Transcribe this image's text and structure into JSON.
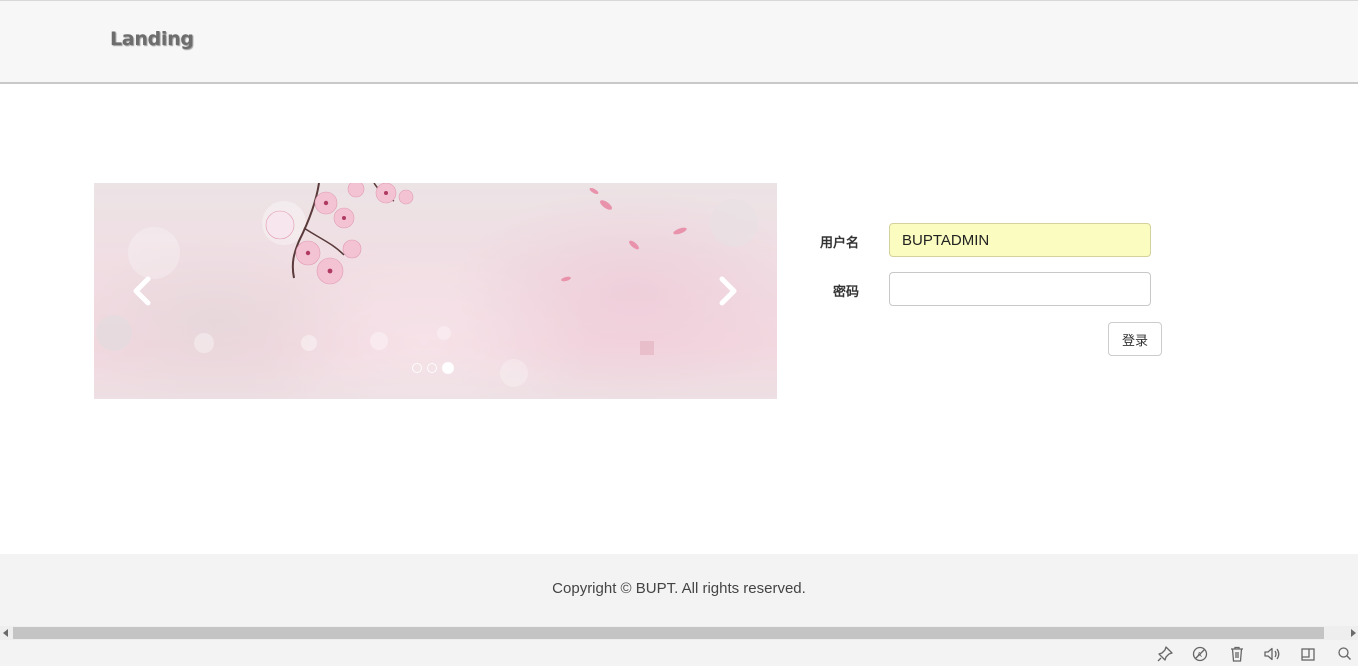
{
  "header": {
    "brand": "Landing"
  },
  "carousel": {
    "indicator_count": 3,
    "active_index": 2
  },
  "login_form": {
    "username_label": "用户名",
    "username_value": "BUPTADMIN",
    "password_label": "密码",
    "password_value": "",
    "submit_label": "登录"
  },
  "footer": {
    "copyright": "Copyright © BUPT. All rights reserved."
  },
  "browser_bar": {
    "icons": [
      "pin-icon",
      "no-ads-icon",
      "trash-icon",
      "speaker-icon",
      "window-icon",
      "search-icon"
    ]
  },
  "colors": {
    "header_bg": "#f7f7f7",
    "username_autofill_bg": "#fafcc0",
    "footer_bg": "#f3f3f3",
    "carousel_tint": "#f3d8e0"
  }
}
